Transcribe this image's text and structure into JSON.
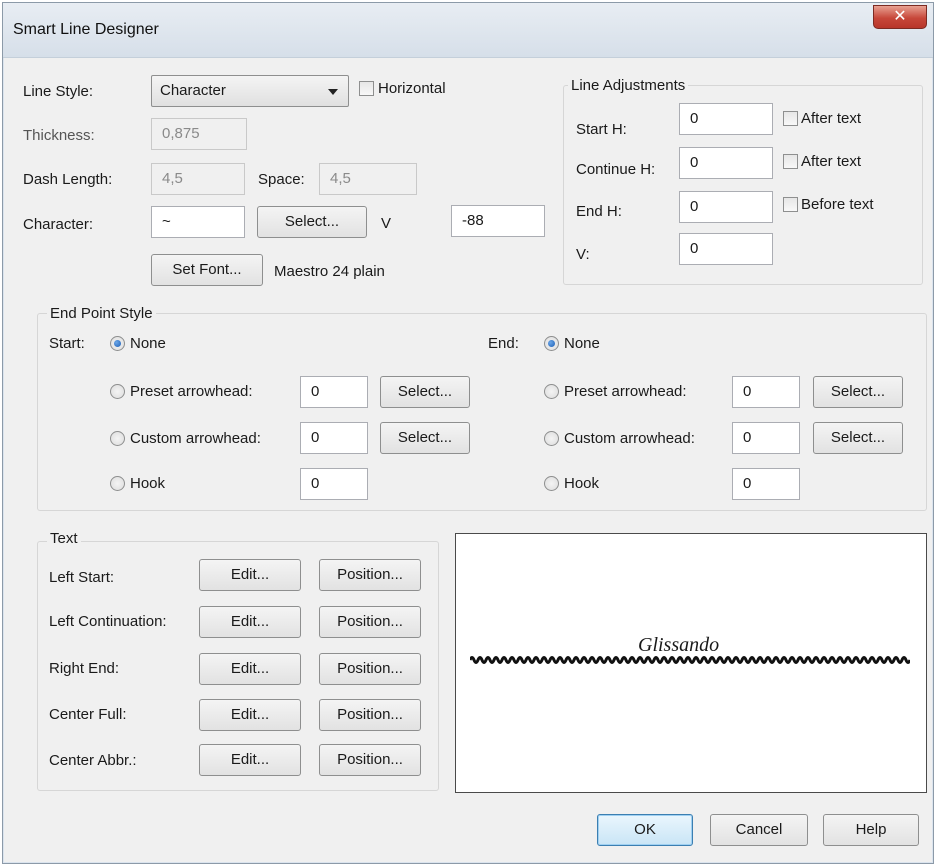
{
  "window": {
    "title": "Smart Line Designer",
    "close_icon": "close-icon"
  },
  "line": {
    "style_label": "Line Style:",
    "style_value": "Character",
    "horizontal_label": "Horizontal",
    "horizontal_checked": false,
    "thickness_label": "Thickness:",
    "thickness_value": "0,875",
    "dash_length_label": "Dash Length:",
    "dash_length_value": "4,5",
    "space_label": "Space:",
    "space_value": "4,5",
    "character_label": "Character:",
    "character_value": "~",
    "select_button": "Select...",
    "v_label": "V",
    "v_value": "-88",
    "set_font_button": "Set Font...",
    "font_name": "Maestro 24 plain"
  },
  "adjustments": {
    "title": "Line Adjustments",
    "start_h_label": "Start H:",
    "start_h_value": "0",
    "start_after_label": "After text",
    "continue_h_label": "Continue H:",
    "continue_h_value": "0",
    "continue_after_label": "After text",
    "end_h_label": "End H:",
    "end_h_value": "0",
    "end_before_label": "Before text",
    "v_label": "V:",
    "v_value": "0"
  },
  "endpoints": {
    "title": "End Point Style",
    "start_label": "Start:",
    "end_label": "End:",
    "none_label": "None",
    "preset_label": "Preset arrowhead:",
    "custom_label": "Custom arrowhead:",
    "hook_label": "Hook",
    "select_button": "Select...",
    "start": {
      "preset_value": "0",
      "custom_value": "0",
      "hook_value": "0"
    },
    "end": {
      "preset_value": "0",
      "custom_value": "0",
      "hook_value": "0"
    }
  },
  "text": {
    "title": "Text",
    "edit_button": "Edit...",
    "position_button": "Position...",
    "rows": [
      "Left Start:",
      "Left Continuation:",
      "Right End:",
      "Center Full:",
      "Center Abbr.:"
    ]
  },
  "preview": {
    "text": "Glissando"
  },
  "footer": {
    "ok": "OK",
    "cancel": "Cancel",
    "help": "Help"
  }
}
